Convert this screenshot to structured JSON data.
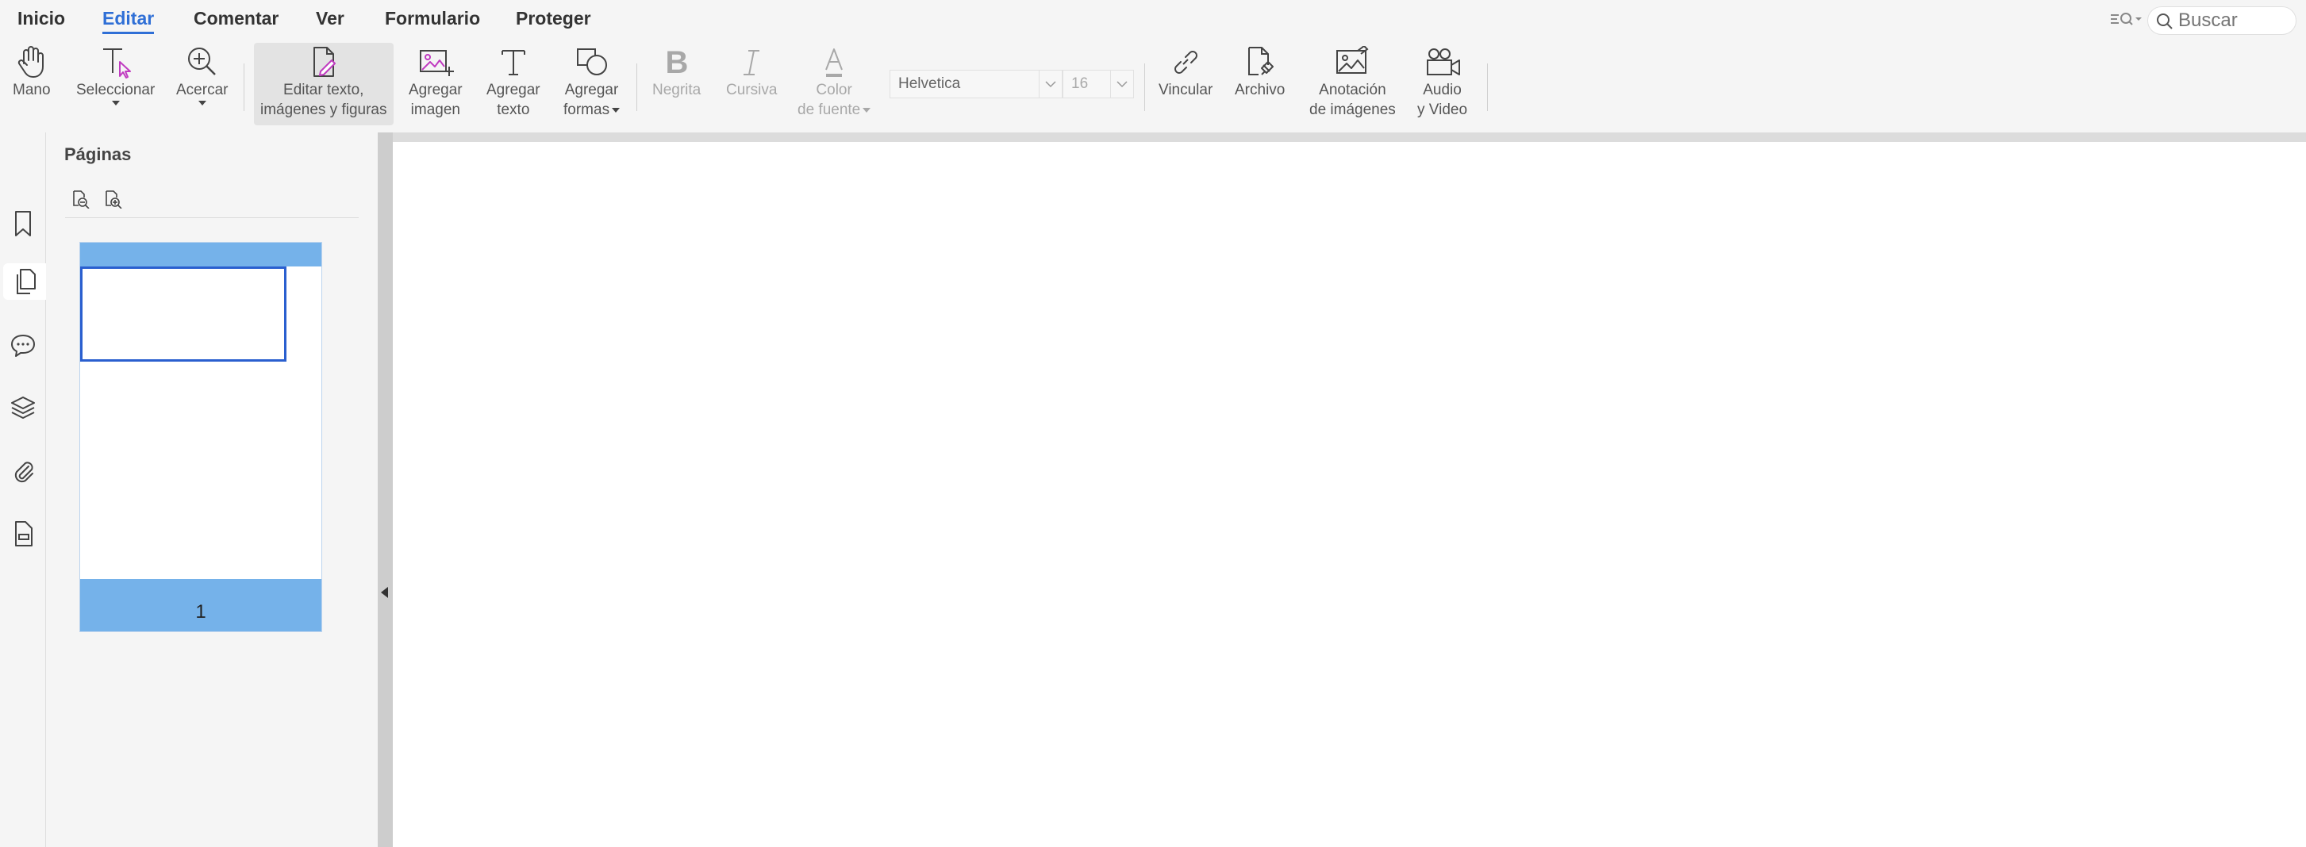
{
  "menu": {
    "items": [
      "Inicio",
      "Editar",
      "Comentar",
      "Ver",
      "Formulario",
      "Proteger"
    ],
    "active": "Editar"
  },
  "search": {
    "placeholder": "Buscar"
  },
  "toolbar": {
    "hand": "Mano",
    "select": "Seleccionar",
    "zoom": "Acercar",
    "edit_line1": "Editar texto,",
    "edit_line2": "imágenes y figuras",
    "add_image_line1": "Agregar",
    "add_image_line2": "imagen",
    "add_text_line1": "Agregar",
    "add_text_line2": "texto",
    "add_shapes_line1": "Agregar",
    "add_shapes_line2": "formas",
    "bold": "Negrita",
    "italic": "Cursiva",
    "font_color_line1": "Color",
    "font_color_line2": "de fuente",
    "font_name": "Helvetica",
    "font_size": "16",
    "link": "Vincular",
    "file": "Archivo",
    "image_annotation_line1": "Anotación",
    "image_annotation_line2": "de imágenes",
    "audio_video_line1": "Audio",
    "audio_video_line2": "y Video"
  },
  "sidebar": {
    "icons": [
      "bookmark-icon",
      "pages-icon",
      "comments-icon",
      "layers-icon",
      "attachment-icon",
      "form-fields-icon"
    ],
    "active": "pages-icon"
  },
  "pages_panel": {
    "title": "Páginas",
    "thumbnail_page_number": "1"
  },
  "colors": {
    "accent": "#2f6fd6",
    "thumb_highlight": "#75b2ea",
    "viewport_border": "#2a5fcf"
  }
}
